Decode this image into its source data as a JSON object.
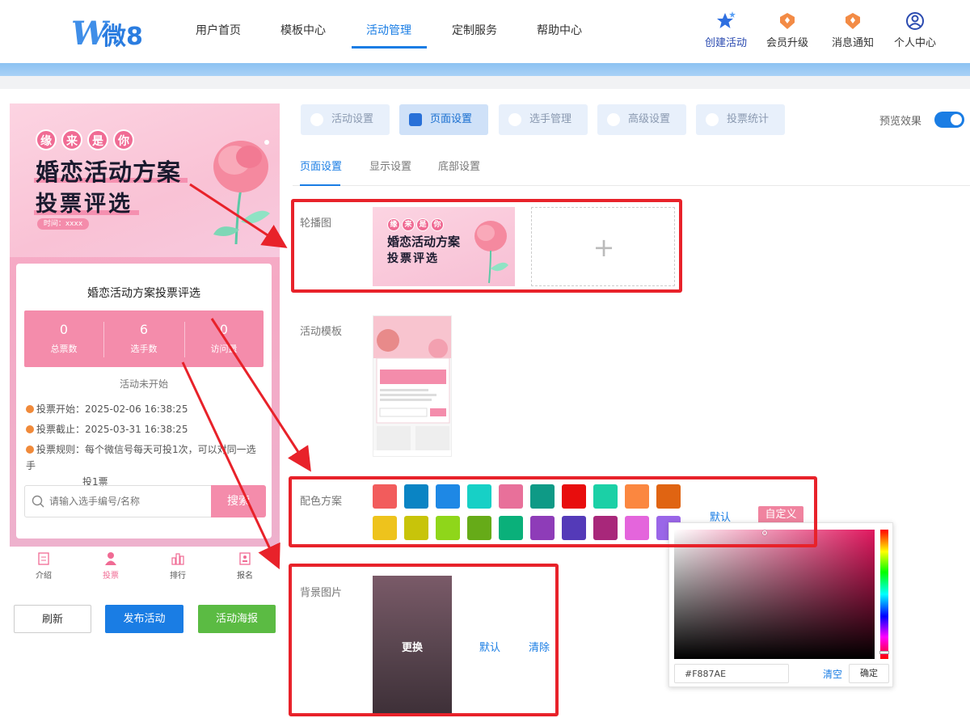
{
  "logo": {
    "mark": "W",
    "text": "微8"
  },
  "nav": {
    "items": [
      {
        "label": "用户首页"
      },
      {
        "label": "模板中心"
      },
      {
        "label": "活动管理"
      },
      {
        "label": "定制服务"
      },
      {
        "label": "帮助中心"
      }
    ],
    "active": "活动管理"
  },
  "top_actions": [
    {
      "label": "创建活动",
      "icon": "star-icon"
    },
    {
      "label": "会员升级",
      "icon": "badge-icon"
    },
    {
      "label": "消息通知",
      "icon": "badge-icon"
    },
    {
      "label": "个人中心",
      "icon": "user-icon"
    }
  ],
  "phone": {
    "banner": {
      "circles": [
        "缘",
        "来",
        "是",
        "你"
      ],
      "title_line1": "婚恋活动方案",
      "title_line2": "投票评选",
      "time": "时间：xxxx"
    },
    "card_title": "婚恋活动方案投票评选",
    "stats": [
      {
        "value": "0",
        "label": "总票数"
      },
      {
        "value": "6",
        "label": "选手数"
      },
      {
        "value": "0",
        "label": "访问量"
      }
    ],
    "status": "活动未开始",
    "info": [
      {
        "text": "投票开始：2025-02-06 16:38:25"
      },
      {
        "text": "投票截止：2025-03-31 16:38:25"
      },
      {
        "text_line1": "投票规则：每个微信号每天可投1次，可以对同一选手",
        "text_line2": "投1票"
      }
    ],
    "search": {
      "placeholder": "请输入选手编号/名称",
      "button": "搜索"
    },
    "tabbar": [
      {
        "label": "介绍",
        "icon": "document-icon"
      },
      {
        "label": "投票",
        "icon": "person-icon"
      },
      {
        "label": "排行",
        "icon": "ranking-icon"
      },
      {
        "label": "报名",
        "icon": "signup-icon"
      }
    ],
    "active_tab": "投票"
  },
  "actions": {
    "refresh": "刷新",
    "publish": "发布活动",
    "poster": "活动海报"
  },
  "panel_tabs": [
    {
      "label": "活动设置",
      "icon": "heart-icon"
    },
    {
      "label": "页面设置",
      "icon": "page-icon"
    },
    {
      "label": "选手管理",
      "icon": "person-icon"
    },
    {
      "label": "高级设置",
      "icon": "advanced-icon"
    },
    {
      "label": "投票统计",
      "icon": "stats-icon"
    }
  ],
  "active_panel_tab": "页面设置",
  "preview": {
    "label": "预览效果",
    "enabled": true
  },
  "sub_tabs": [
    {
      "label": "页面设置"
    },
    {
      "label": "显示设置"
    },
    {
      "label": "底部设置"
    }
  ],
  "sections": {
    "carousel": {
      "label": "轮播图",
      "add_symbol": "+"
    },
    "template": {
      "label": "活动模板"
    },
    "color_scheme": {
      "label": "配色方案",
      "colors_row1": [
        "#f25c5c",
        "#0a84c4",
        "#1e88e5",
        "#17d0c6",
        "#e8709a",
        "#0e9a86",
        "#e80d0d",
        "#1bd0a6",
        "#fb8740",
        "#e06412"
      ],
      "colors_row2": [
        "#eec31c",
        "#c8c40a",
        "#8fd61a",
        "#66ab18",
        "#0ab07a",
        "#8e3cb8",
        "#543ab8",
        "#a8277a",
        "#e465dc",
        "#9a66e8"
      ],
      "default": "默认",
      "custom": "自定义"
    },
    "background": {
      "label": "背景图片",
      "change": "更换",
      "default": "默认",
      "clear": "清除"
    }
  },
  "color_picker": {
    "value": "#F887AE",
    "clear": "清空",
    "ok": "确定"
  },
  "colors": {
    "brand_blue": "#1a7de4",
    "pink": "#f48cab",
    "red_highlight": "#e8222a"
  }
}
